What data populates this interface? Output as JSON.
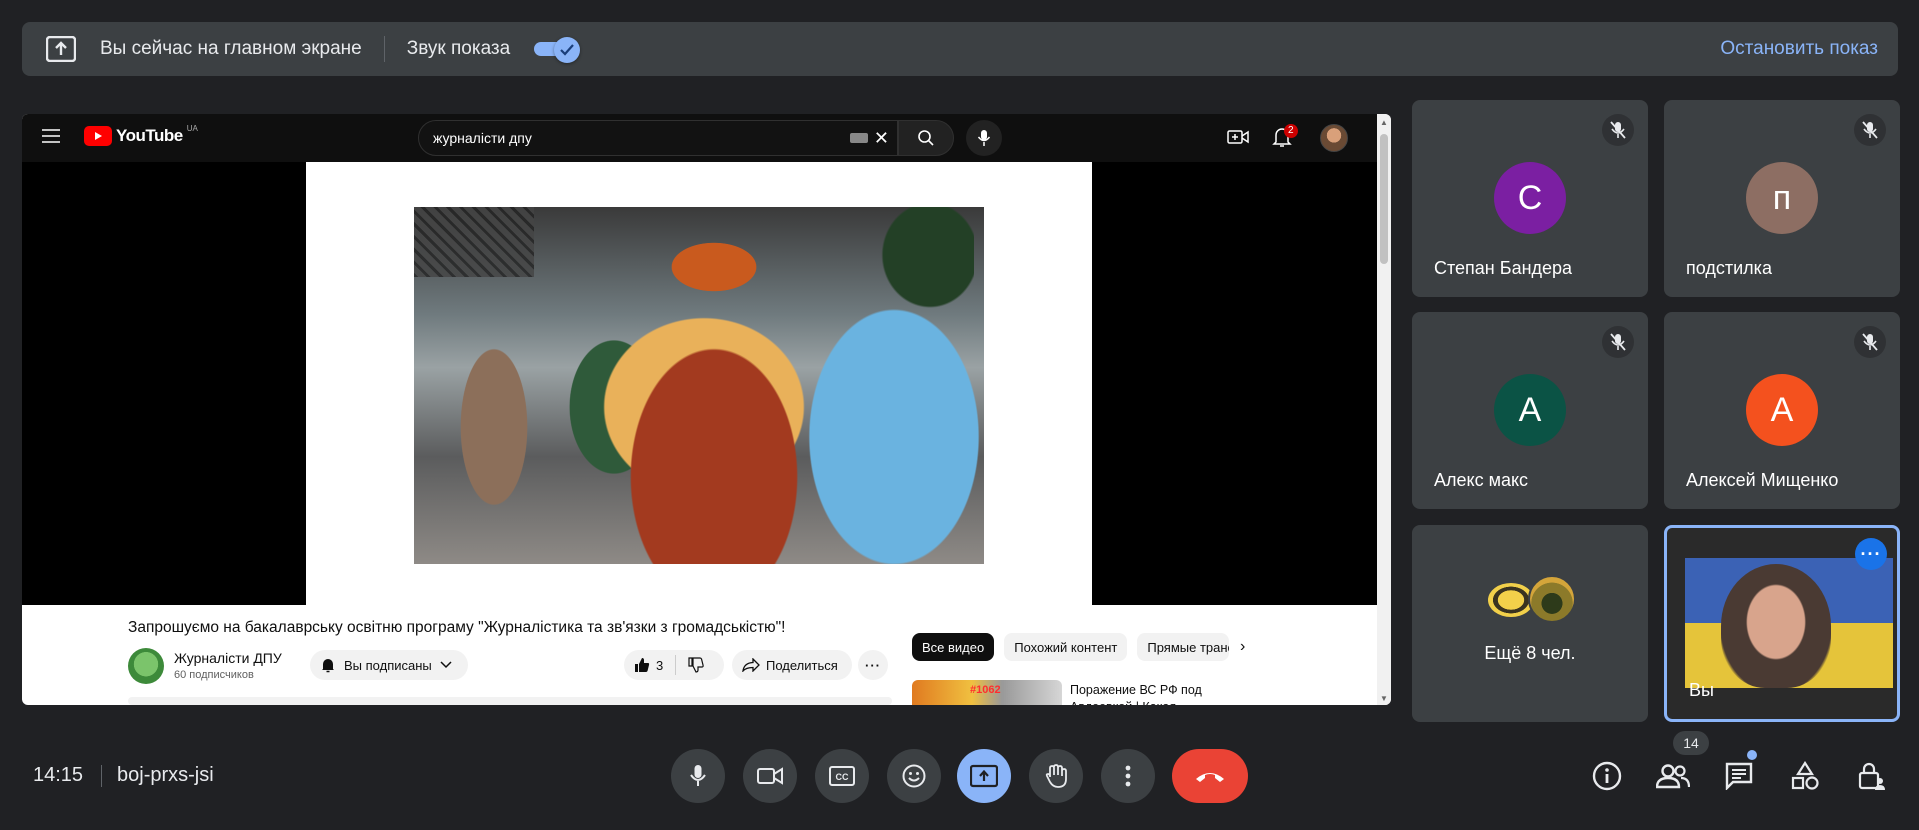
{
  "banner": {
    "message": "Вы сейчас на главном экране",
    "sound_label": "Звук показа",
    "sound_on": true,
    "stop_label": "Остановить показ"
  },
  "youtube": {
    "logo_text": "YouTube",
    "region": "UA",
    "search_value": "журналісти дпу",
    "notifications_count": "2",
    "video_title": "Запрошуємо на бакалаврську освітню програму \"Журналістика та зв'язки з громадськістю\"!",
    "channel_name": "Журналісти ДПУ",
    "channel_subs": "60 подписчиков",
    "subscribed_label": "Вы подписаны",
    "likes": "3",
    "share_label": "Поделиться",
    "chips": [
      "Все видео",
      "Похожий контент",
      "Прямые трансляции"
    ],
    "rec_badge": "#1062",
    "rec_title": "Поражение ВС РФ под Авдеевкой | Какая ...."
  },
  "participants": [
    {
      "name": "Степан Бандера",
      "initial": "С",
      "color": "#7b1fa2",
      "muted": true
    },
    {
      "name": "подстилка",
      "initial": "п",
      "color": "#8d6e63",
      "muted": true
    },
    {
      "name": "Алекс макс",
      "initial": "А",
      "color": "#0b5345",
      "muted": true
    },
    {
      "name": "Алексей Мищенко",
      "initial": "А",
      "color": "#f4511e",
      "muted": true
    }
  ],
  "more_tile": {
    "label": "Ещё 8 чел."
  },
  "self_tile": {
    "name": "Вы"
  },
  "meeting": {
    "time": "14:15",
    "code": "boj-prxs-jsi",
    "participants_count": "14"
  }
}
